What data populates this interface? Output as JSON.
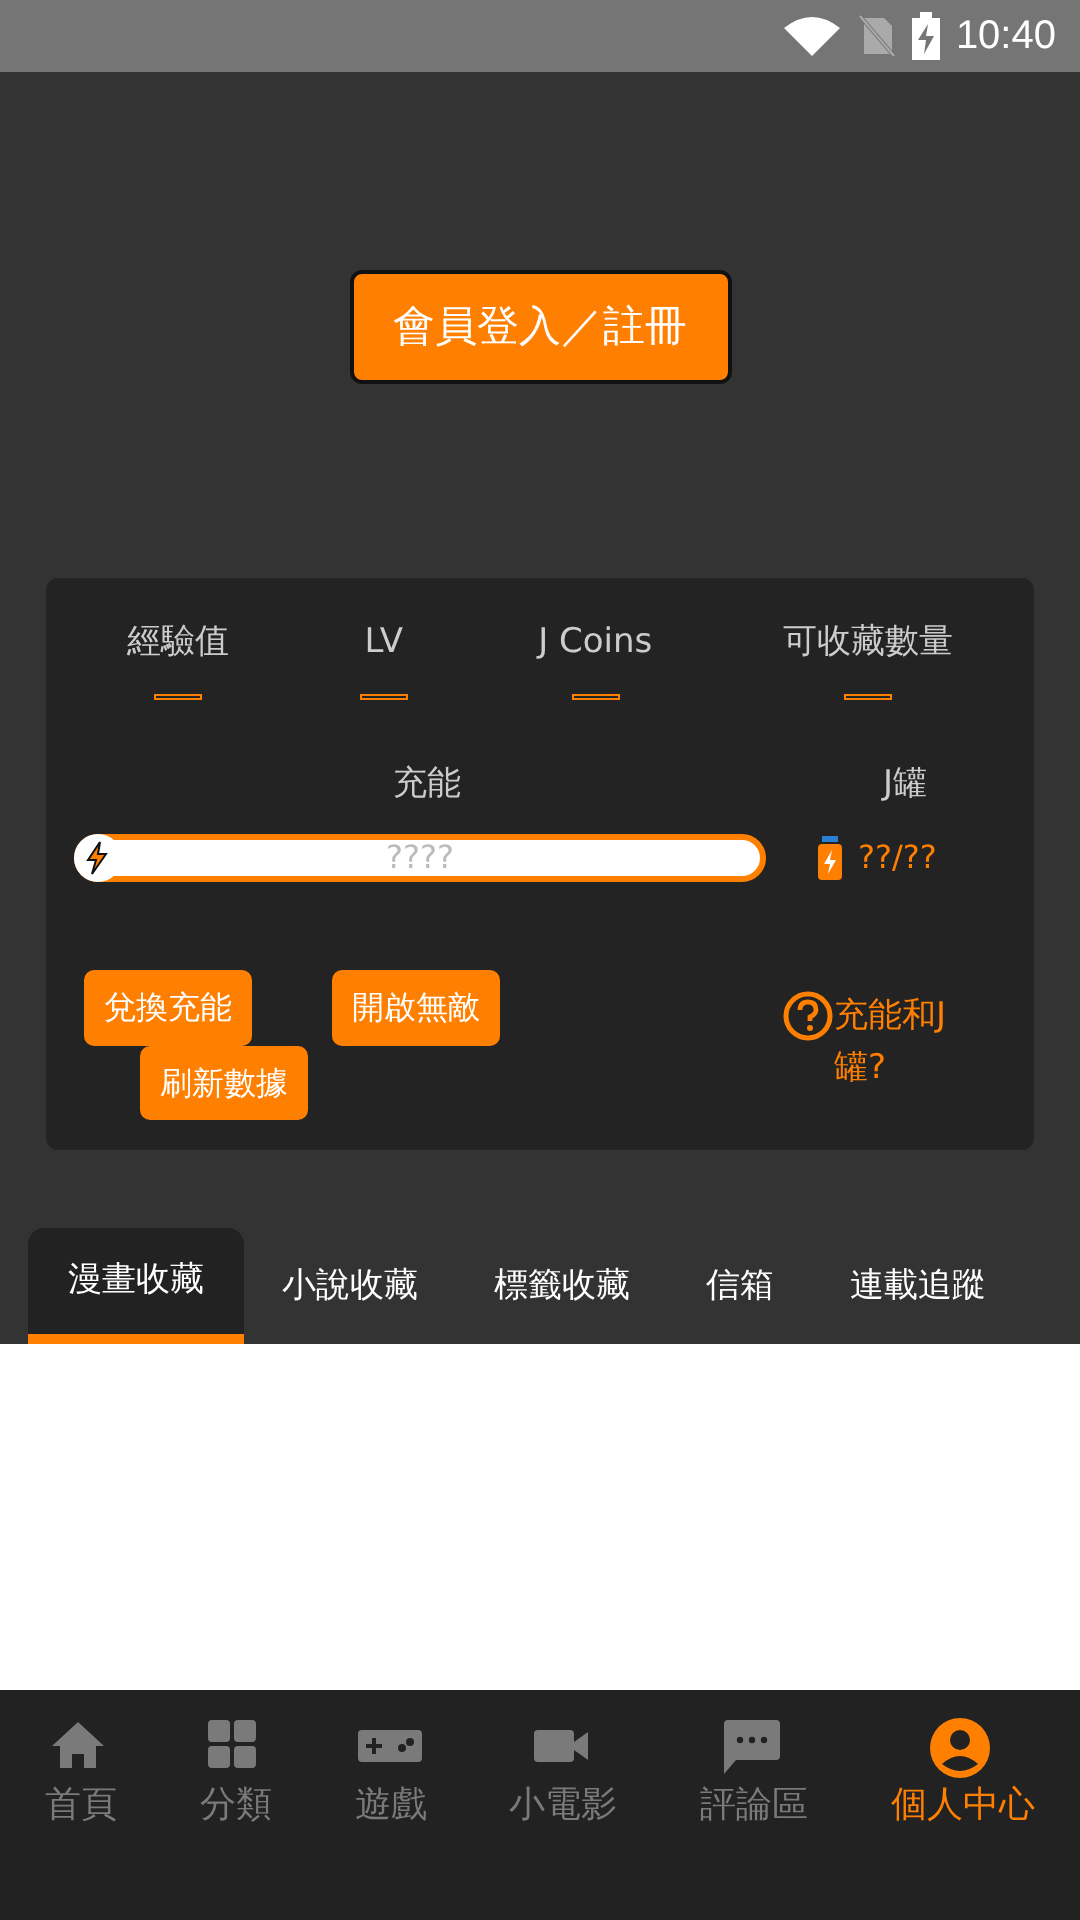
{
  "status_bar": {
    "time": "10:40"
  },
  "login_button": "會員登入／註冊",
  "stats": [
    {
      "label": "經驗值"
    },
    {
      "label": "LV"
    },
    {
      "label": "J Coins"
    },
    {
      "label": "可收藏數量"
    }
  ],
  "charge": {
    "label": "充能",
    "bar_text": "????"
  },
  "jar": {
    "label": "J罐",
    "value": "??/??"
  },
  "actions": [
    "兌換充能",
    "開啟無敵",
    "刷新數據"
  ],
  "help_link": "充能和J罐?",
  "tabs": [
    {
      "label": "漫畫收藏",
      "selected": true
    },
    {
      "label": "小說收藏",
      "selected": false
    },
    {
      "label": "標籤收藏",
      "selected": false
    },
    {
      "label": "信箱",
      "selected": false
    },
    {
      "label": "連載追蹤",
      "selected": false
    }
  ],
  "bottom_nav": [
    {
      "label": "首頁",
      "kind": "home",
      "selected": false
    },
    {
      "label": "分類",
      "kind": "grid",
      "selected": false
    },
    {
      "label": "遊戲",
      "kind": "game",
      "selected": false
    },
    {
      "label": "小電影",
      "kind": "video",
      "selected": false
    },
    {
      "label": "評論區",
      "kind": "chat",
      "selected": false
    },
    {
      "label": "個人中心",
      "kind": "person",
      "selected": true
    }
  ]
}
